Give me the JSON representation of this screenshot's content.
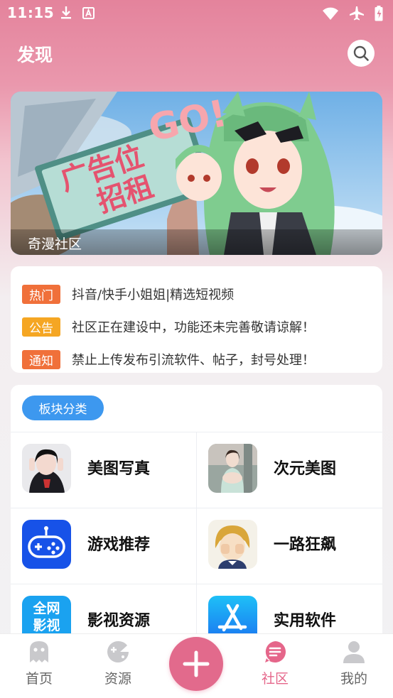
{
  "status_bar": {
    "time": "11:15"
  },
  "header": {
    "title": "发现"
  },
  "banner": {
    "caption": "奇漫社区",
    "sign_line1": "广告位",
    "sign_line2": "招租"
  },
  "notices": [
    {
      "tag": "热门",
      "text": "抖音/快手小姐姐|精选短视频",
      "color": "#f0703a"
    },
    {
      "tag": "公告",
      "text": "社区正在建设中，功能还未完善敬请谅解！",
      "color": "#f5a623"
    },
    {
      "tag": "通知",
      "text": "禁止上传发布引流软件、帖子，封号处理！",
      "color": "#f0703a"
    }
  ],
  "categories": {
    "title": "板块分类",
    "items": [
      {
        "label": "美图写真",
        "icon": "portrait-photo-thumb"
      },
      {
        "label": "次元美图",
        "icon": "anime-photo-thumb"
      },
      {
        "label": "游戏推荐",
        "icon": "gamepad-icon"
      },
      {
        "label": "一路狂飙",
        "icon": "cartoon-face-thumb"
      },
      {
        "label": "影视资源",
        "icon": "movie-badge-icon",
        "badge_line1": "全网",
        "badge_line2": "影视"
      },
      {
        "label": "实用软件",
        "icon": "app-store-icon"
      }
    ]
  },
  "tabbar": {
    "items": [
      {
        "label": "首页",
        "icon": "ghost-icon",
        "active": false
      },
      {
        "label": "资源",
        "icon": "gamepad-round-icon",
        "active": false
      },
      {
        "label": "社区",
        "icon": "community-icon",
        "active": true
      },
      {
        "label": "我的",
        "icon": "person-icon",
        "active": false
      }
    ]
  },
  "colors": {
    "accent": "#e26a8c",
    "header_pink": "#e4839c",
    "pill_blue": "#3d98ef"
  }
}
